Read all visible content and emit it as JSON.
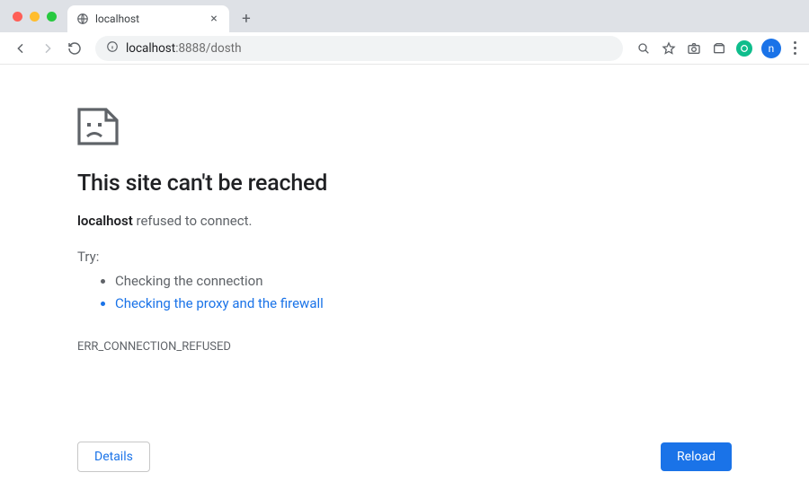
{
  "tab": {
    "title": "localhost"
  },
  "omnibox": {
    "host": "localhost",
    "rest": ":8888/dosth"
  },
  "avatar": {
    "initial": "n"
  },
  "error": {
    "title": "This site can't be reached",
    "host": "localhost",
    "msg_suffix": " refused to connect.",
    "try_label": "Try:",
    "suggestion1": "Checking the connection",
    "suggestion2": "Checking the proxy and the firewall",
    "code": "ERR_CONNECTION_REFUSED"
  },
  "buttons": {
    "details": "Details",
    "reload": "Reload"
  }
}
